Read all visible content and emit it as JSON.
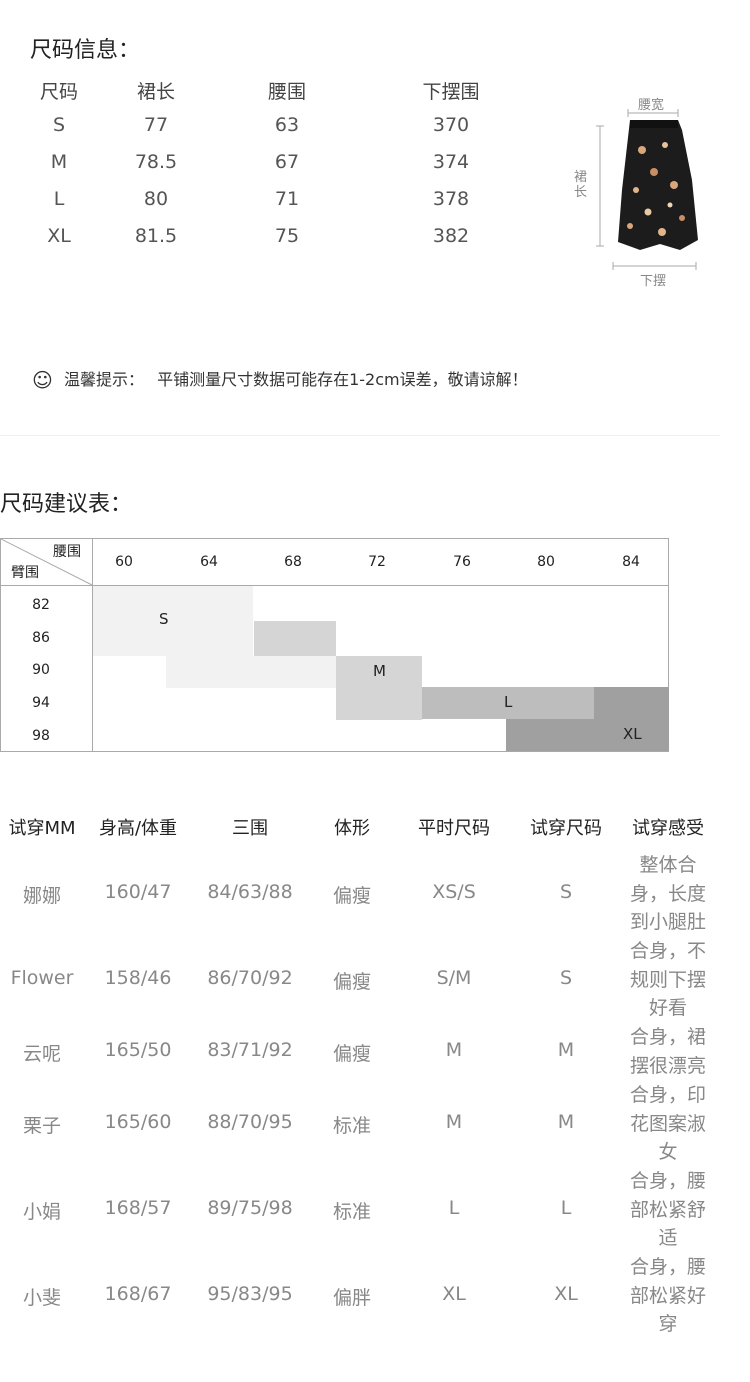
{
  "size_info": {
    "title": "尺码信息：",
    "headers": [
      "尺码",
      "裙长",
      "腰围",
      "下摆围"
    ],
    "rows": [
      [
        "S",
        "77",
        "63",
        "370"
      ],
      [
        "M",
        "78.5",
        "67",
        "374"
      ],
      [
        "L",
        "80",
        "71",
        "378"
      ],
      [
        "XL",
        "81.5",
        "75",
        "382"
      ]
    ],
    "diagram": {
      "waist_label": "腰宽",
      "length_label": "裙长",
      "hem_label": "下摆"
    }
  },
  "tip": {
    "icon": "smiley-icon",
    "label": "温馨提示：",
    "text": "平铺测量尺寸数据可能存在1-2cm误差，敬请谅解！"
  },
  "recommend": {
    "title": "尺码建议表：",
    "corner_top": "腰围",
    "corner_bottom": "臂围",
    "columns": [
      "60",
      "64",
      "68",
      "72",
      "76",
      "80",
      "84"
    ],
    "rows": [
      "82",
      "86",
      "90",
      "94",
      "98"
    ],
    "sizes": [
      "S",
      "M",
      "L",
      "XL"
    ],
    "colors": {
      "S": "#f2f2f2",
      "S2": "#d5d5d5",
      "M": "#d5d5d5",
      "L": "#bdbdbd",
      "XL": "#a0a0a0"
    }
  },
  "tryon": {
    "headers": [
      "试穿MM",
      "身高/体重",
      "三围",
      "体形",
      "平时尺码",
      "试穿尺码",
      "试穿感受"
    ],
    "rows": [
      {
        "name": "娜娜",
        "hw": "160/47",
        "bwh": "84/63/88",
        "shape": "偏瘦",
        "usual": "XS/S",
        "tried": "S",
        "feel": [
          "整体合",
          "身，长度",
          "到小腿肚"
        ]
      },
      {
        "name": "Flower",
        "hw": "158/46",
        "bwh": "86/70/92",
        "shape": "偏瘦",
        "usual": "S/M",
        "tried": "S",
        "feel": [
          "合身，不",
          "规则下摆",
          "好看"
        ]
      },
      {
        "name": "云呢",
        "hw": "165/50",
        "bwh": "83/71/92",
        "shape": "偏瘦",
        "usual": "M",
        "tried": "M",
        "feel": [
          "合身，裙",
          "摆很漂亮"
        ]
      },
      {
        "name": "栗子",
        "hw": "165/60",
        "bwh": "88/70/95",
        "shape": "标准",
        "usual": "M",
        "tried": "M",
        "feel": [
          "合身，印",
          "花图案淑",
          "女"
        ]
      },
      {
        "name": "小娟",
        "hw": "168/57",
        "bwh": "89/75/98",
        "shape": "标准",
        "usual": "L",
        "tried": "L",
        "feel": [
          "合身，腰",
          "部松紧舒",
          "适"
        ]
      },
      {
        "name": "小斐",
        "hw": "168/67",
        "bwh": "95/83/95",
        "shape": "偏胖",
        "usual": "XL",
        "tried": "XL",
        "feel": [
          "合身，腰",
          "部松紧好",
          "穿"
        ]
      }
    ]
  }
}
